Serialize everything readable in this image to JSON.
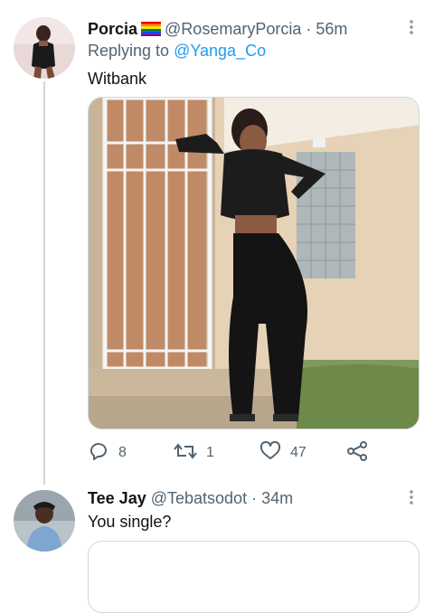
{
  "tweets": [
    {
      "display_name": "Porcia",
      "flag_icon": "rainbow-flag-icon",
      "handle": "@RosemaryPorcia",
      "separator": "·",
      "time": "56m",
      "replying_prefix": "Replying to",
      "replying_handle": "@Yanga_Co",
      "text": "Witbank",
      "actions": {
        "replies": "8",
        "retweets": "1",
        "likes": "47"
      }
    },
    {
      "display_name": "Tee Jay",
      "handle": "@Tebatsodot",
      "separator": "·",
      "time": "34m",
      "text": "You single?"
    }
  ],
  "colors": {
    "text_primary": "#0f1419",
    "text_secondary": "#536471",
    "link": "#1d9bf0",
    "border": "#cfd9de"
  },
  "icons": [
    "more-icon",
    "reply-icon",
    "retweet-icon",
    "like-icon",
    "share-icon"
  ]
}
